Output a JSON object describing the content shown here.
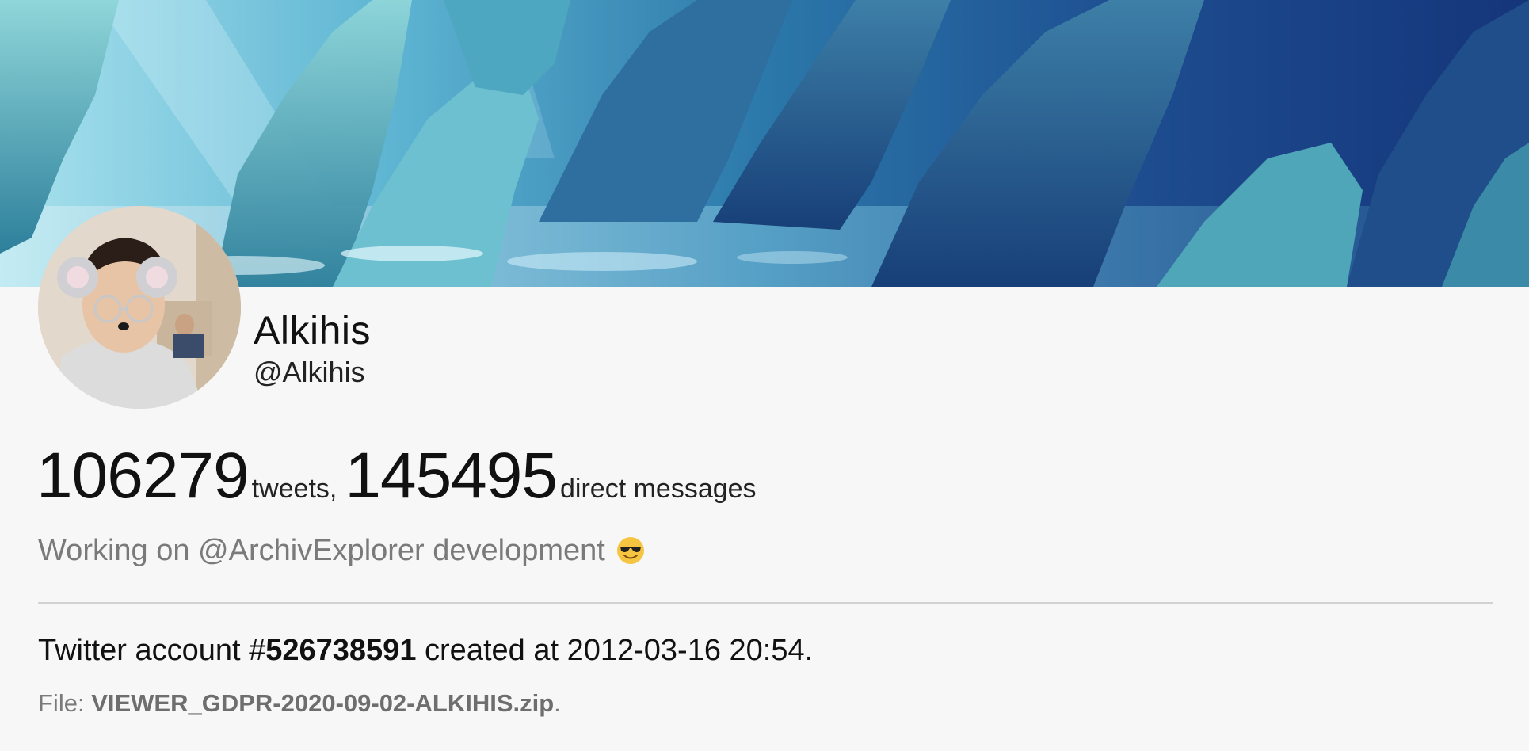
{
  "profile": {
    "display_name": "Alkihis",
    "handle": "@Alkihis",
    "bio": "Working on @ArchivExplorer development",
    "bio_emoji": "smiling-face-with-sunglasses-icon"
  },
  "stats": {
    "tweets_count": "106279",
    "tweets_label": "tweets,",
    "dms_count": "145495",
    "dms_label": "direct messages"
  },
  "account": {
    "prefix": "Twitter account #",
    "id": "526738591",
    "created_text": " created at 2012-03-16 20:54."
  },
  "file": {
    "label": "File: ",
    "name": "VIEWER_GDPR-2020-09-02-ALKIHIS.zip",
    "suffix": "."
  },
  "colors": {
    "background": "#f7f7f7",
    "muted_text": "#7a7a7a",
    "divider": "#d2d2d2"
  }
}
